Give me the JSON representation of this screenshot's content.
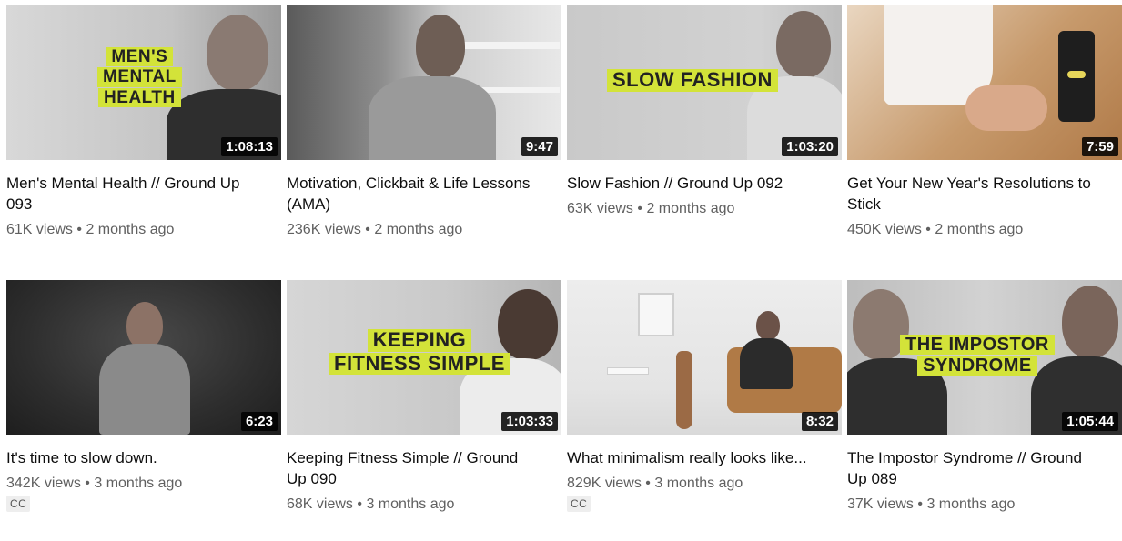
{
  "videos": [
    {
      "overlay": [
        "MEN'S",
        "MENTAL",
        "HEALTH"
      ],
      "duration": "1:08:13",
      "title": "Men's Mental Health // Ground Up 093",
      "views": "61K views",
      "age": "2 months ago",
      "cc": ""
    },
    {
      "overlay": [],
      "duration": "9:47",
      "title": "Motivation, Clickbait & Life Lessons (AMA)",
      "views": "236K views",
      "age": "2 months ago",
      "cc": ""
    },
    {
      "overlay": [
        "SLOW FASHION"
      ],
      "duration": "1:03:20",
      "title": "Slow Fashion // Ground Up 092",
      "views": "63K views",
      "age": "2 months ago",
      "cc": ""
    },
    {
      "overlay": [],
      "duration": "7:59",
      "title": "Get Your New Year's Resolutions to Stick",
      "views": "450K views",
      "age": "2 months ago",
      "cc": ""
    },
    {
      "overlay": [],
      "duration": "6:23",
      "title": "It's time to slow down.",
      "views": "342K views",
      "age": "3 months ago",
      "cc": "CC"
    },
    {
      "overlay": [
        "KEEPING",
        "FITNESS SIMPLE"
      ],
      "duration": "1:03:33",
      "title": "Keeping Fitness Simple // Ground Up 090",
      "views": "68K views",
      "age": "3 months ago",
      "cc": ""
    },
    {
      "overlay": [],
      "duration": "8:32",
      "title": "What minimalism really looks like...",
      "views": "829K views",
      "age": "3 months ago",
      "cc": "CC"
    },
    {
      "overlay": [
        "THE IMPOSTOR",
        "SYNDROME"
      ],
      "duration": "1:05:44",
      "title": "The Impostor Syndrome // Ground Up 089",
      "views": "37K views",
      "age": "3 months ago",
      "cc": ""
    }
  ],
  "separator": "•",
  "colors": {
    "overlay_bg": "#d3e339",
    "meta_text": "#606060",
    "title_text": "#0d0d0d"
  }
}
